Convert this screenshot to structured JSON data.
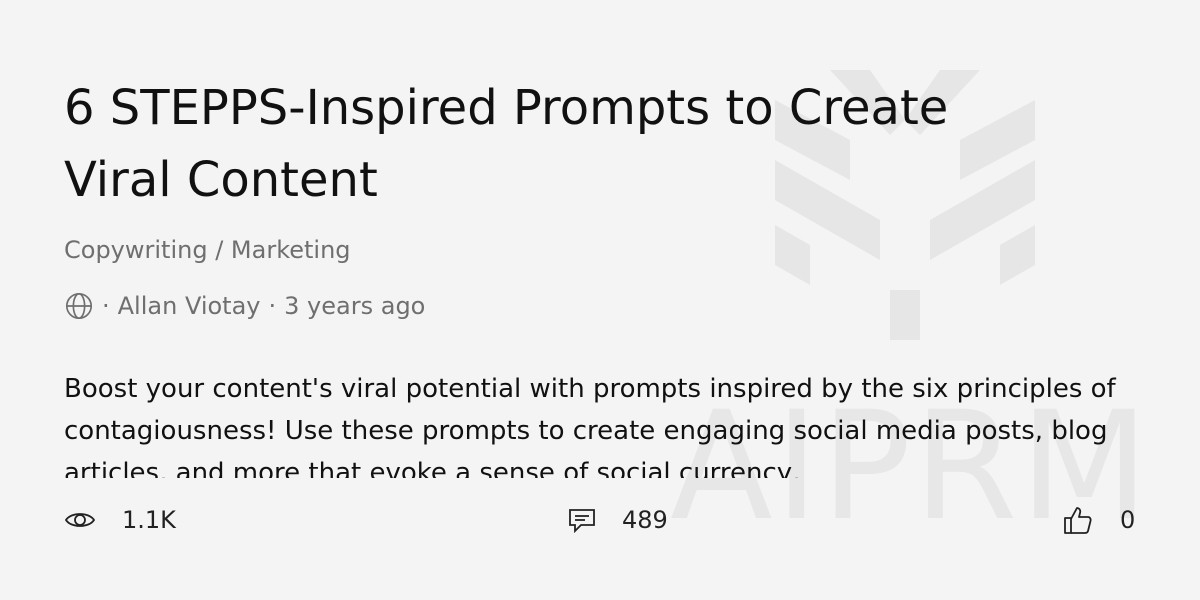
{
  "post": {
    "title": "6 STEPPS-Inspired Prompts to Create Viral Content",
    "category": "Copywriting / Marketing",
    "separator": "·",
    "author": "Allan Viotay",
    "time_ago": "3 years ago",
    "description": "Boost your content's viral potential with prompts inspired by the six principles of contagiousness! Use these prompts to create engaging social media posts, blog articles, and more that evoke a sense of social currency,"
  },
  "stats": {
    "views": "1.1K",
    "comments": "489",
    "likes": "0"
  },
  "watermark": {
    "text": "AIPRM",
    "color": "#e6e6e6"
  },
  "icons": {
    "visibility": "globe-icon",
    "views": "eye-icon",
    "comments": "comment-icon",
    "likes": "thumbs-up-icon"
  }
}
